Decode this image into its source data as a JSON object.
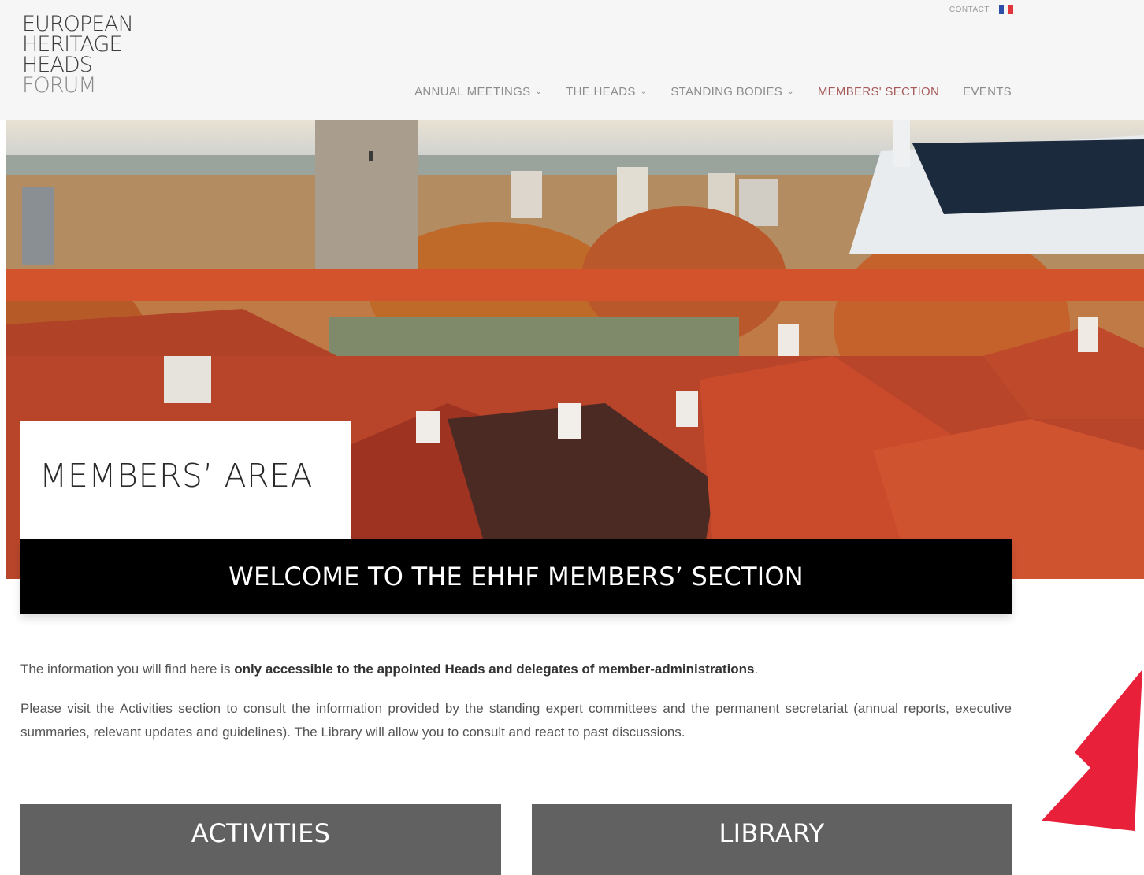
{
  "logo": {
    "line1": "EUROPEAN",
    "line2": "HERITAGE",
    "line3": "HEADS",
    "line4": "FORUM"
  },
  "topbar": {
    "contact": "CONTACT",
    "flag_icon": "france-flag-icon"
  },
  "nav": {
    "items": [
      {
        "label": "ANNUAL MEETINGS"
      },
      {
        "label": "THE HEADS"
      },
      {
        "label": "STANDING BODIES"
      },
      {
        "label": "MEMBERS' SECTION"
      },
      {
        "label": "EVENTS"
      }
    ]
  },
  "hero": {
    "title": "MEMBERS’ AREA"
  },
  "welcome": "WELCOME TO THE EHHF MEMBERS’ SECTION",
  "content": {
    "p1_start": "The information you will find here is ",
    "p1_bold": "only accessible to the appointed Heads and delegates of member-administrations",
    "p1_end": ".",
    "p2": "Please visit the Activities section to consult the information provided by the standing expert committees and the permanent secretariat (annual reports, executive summaries, relevant updates and guidelines). The Library will allow you to consult and react to past discussions."
  },
  "buttons": {
    "activities": "ACTIVITIES",
    "library": "LIBRARY"
  },
  "colors": {
    "accent": "#a85a5a",
    "button_bg": "#616161",
    "arrow": "#e8203a"
  }
}
